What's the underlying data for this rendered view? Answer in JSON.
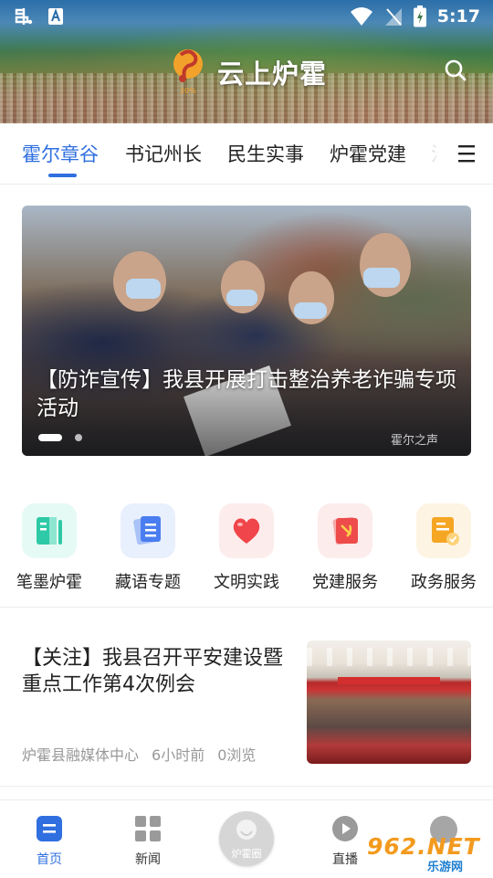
{
  "status_bar": {
    "time": "5:17"
  },
  "header": {
    "title": "云上炉霍"
  },
  "tabs": {
    "items": [
      {
        "label": "霍尔章谷",
        "active": true
      },
      {
        "label": "书记州长",
        "active": false
      },
      {
        "label": "民生实事",
        "active": false
      },
      {
        "label": "炉霍党建",
        "active": false
      },
      {
        "label": "法",
        "active": false
      }
    ]
  },
  "banner": {
    "title": "【防诈宣传】我县开展打击整治养老诈骗专项活动",
    "watermark": "霍尔之声",
    "slide_count": 2,
    "active_slide": 1
  },
  "quick_links": [
    {
      "label": "笔墨炉霍",
      "icon": "book-icon",
      "color": "#2ec9a6"
    },
    {
      "label": "藏语专题",
      "icon": "document-icon",
      "color": "#4a7df0"
    },
    {
      "label": "文明实践",
      "icon": "heart-icon",
      "color": "#f0454a"
    },
    {
      "label": "党建服务",
      "icon": "party-flag-icon",
      "color": "#ee4b4b"
    },
    {
      "label": "政务服务",
      "icon": "service-icon",
      "color": "#f5a623"
    }
  ],
  "news": [
    {
      "title": "【关注】我县召开平安建设暨重点工作第4次例会",
      "source": "炉霍县融媒体中心",
      "time": "6小时前",
      "views": "0浏览"
    }
  ],
  "bottom_nav": {
    "items": [
      {
        "label": "首页",
        "icon": "home-icon",
        "active": true
      },
      {
        "label": "新闻",
        "icon": "grid-icon",
        "active": false
      },
      {
        "label": "炉霍圈",
        "icon": "circle-icon",
        "active": false
      },
      {
        "label": "直播",
        "icon": "play-icon",
        "active": false
      }
    ]
  },
  "watermark_site": {
    "brand": "962.NET",
    "sub": "乐游网"
  },
  "colors": {
    "accent": "#2f6fe0"
  }
}
